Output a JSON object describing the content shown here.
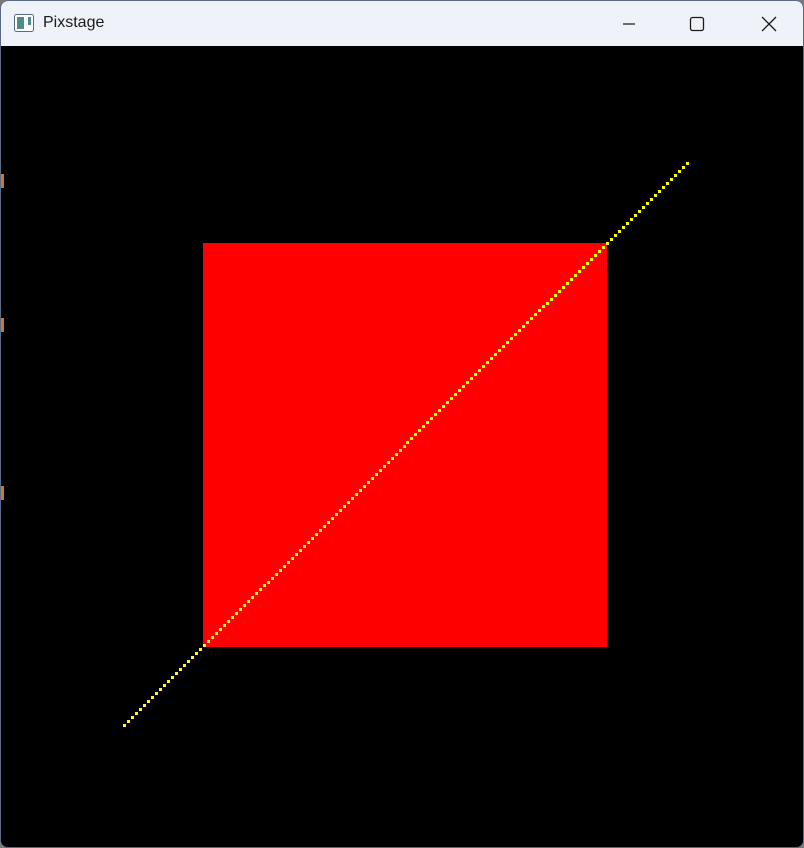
{
  "window": {
    "title": "Pixstage",
    "app_icon": "pixstage-app-icon",
    "controls": {
      "minimize_icon": "minimize-icon",
      "maximize_icon": "maximize-icon",
      "close_icon": "close-icon"
    }
  },
  "stage": {
    "background_color": "#000000",
    "rectangle": {
      "fill_color": "#ff0000"
    },
    "line": {
      "color": "#ffff00",
      "style": "pixelated"
    }
  }
}
